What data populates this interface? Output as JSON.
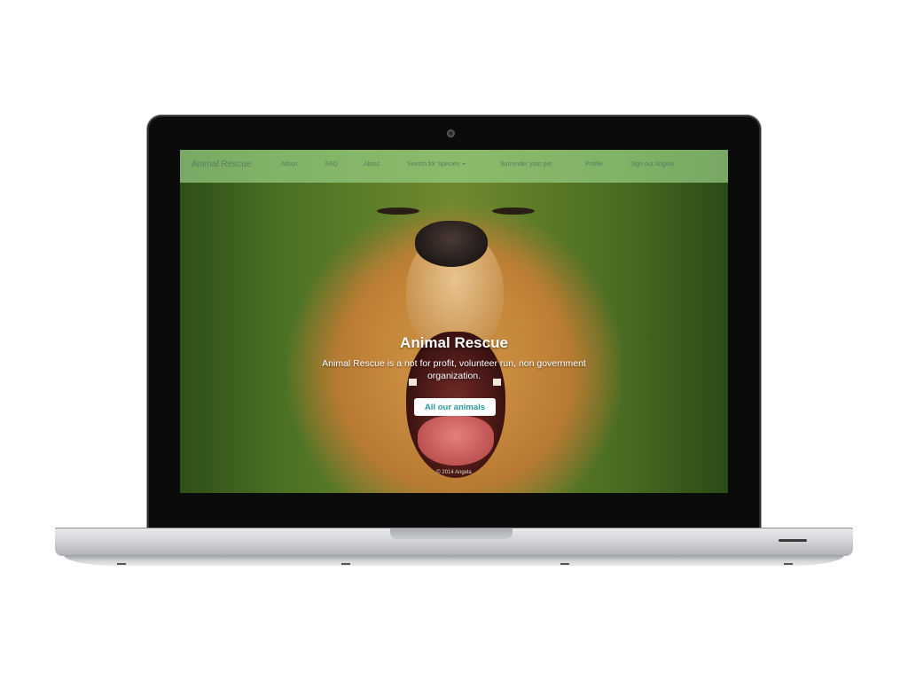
{
  "navbar": {
    "brand": "Animal Rescue",
    "items": [
      {
        "label": "Adopt"
      },
      {
        "label": "FAQ"
      },
      {
        "label": "About"
      },
      {
        "label": "Search for Species"
      },
      {
        "label": "Surrender your pet"
      },
      {
        "label": "Profile"
      },
      {
        "label": "Sign out Angela"
      }
    ]
  },
  "hero": {
    "title": "Animal Rescue",
    "subtitle": "Animal Rescue is a not for profit, volunteer run, non government organization.",
    "button_label": "All our animals"
  },
  "footer": {
    "text": "© 2014 Angela"
  },
  "colors": {
    "navbar_bg": "#96cd82",
    "button_text": "#2b9aa0",
    "laptop_bezel": "#0b0b0b"
  }
}
